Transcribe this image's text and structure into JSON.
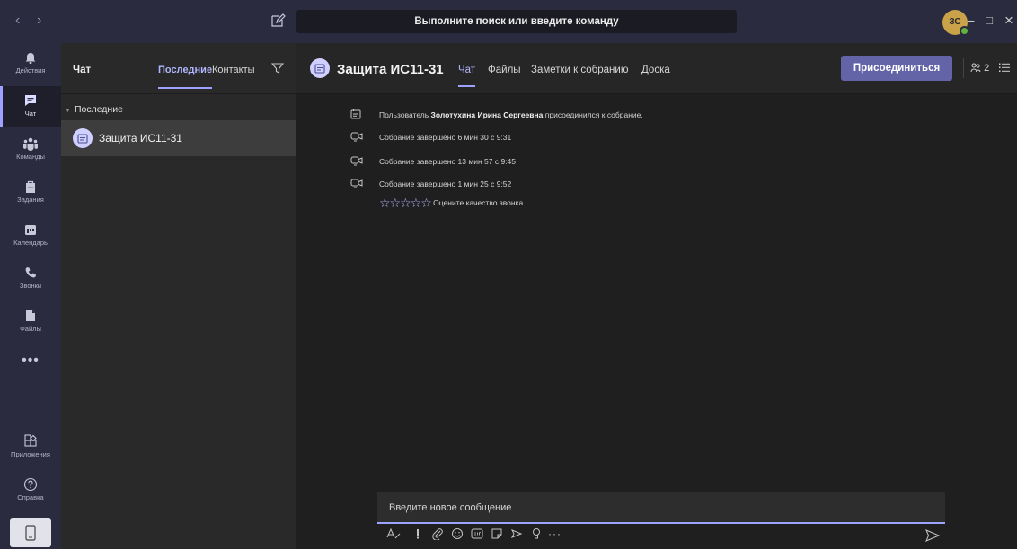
{
  "titlebar": {
    "back": "‹",
    "forward": "›",
    "search_placeholder": "Выполните поиск или введите команду",
    "avatar_initials": "ЗС",
    "minimize": "−",
    "maximize": "□",
    "close": "×"
  },
  "rail": {
    "items": [
      {
        "label": "Действия",
        "icon": "bell-icon"
      },
      {
        "label": "Чат",
        "icon": "chat-icon"
      },
      {
        "label": "Команды",
        "icon": "teams-icon"
      },
      {
        "label": "Задания",
        "icon": "assignments-icon"
      },
      {
        "label": "Календарь",
        "icon": "calendar-icon"
      },
      {
        "label": "Звонки",
        "icon": "phone-icon"
      },
      {
        "label": "Файлы",
        "icon": "file-icon"
      }
    ],
    "more": "•••",
    "apps_label": "Приложения",
    "help_label": "Справка"
  },
  "list": {
    "title": "Чат",
    "tab_recent": "Последние",
    "tab_contacts": "Контакты",
    "section": "Последние",
    "items": [
      {
        "name": "Защита ИС11-31"
      }
    ]
  },
  "main": {
    "title": "Защита ИС11-31",
    "tabs": [
      {
        "label": "Чат"
      },
      {
        "label": "Файлы"
      },
      {
        "label": "Заметки к собранию"
      },
      {
        "label": "Доска"
      }
    ],
    "join_button": "Присоединиться",
    "participants_count": "2",
    "events": [
      {
        "prefix": "Пользователь ",
        "user": "Золотухина Ирина Сергеевна",
        "suffix": " присоединился к собрание."
      },
      {
        "text": "Собрание завершено  6 мин 30 с   9:31"
      },
      {
        "text": "Собрание завершено  13 мин 57 с   9:45"
      },
      {
        "text": "Собрание завершено  1 мин 25 с   9:52"
      }
    ],
    "rating_stars": "☆☆☆☆☆",
    "rating_text": "Оцените качество звонка",
    "composer_placeholder": "Введите новое сообщение"
  },
  "colors": {
    "accent": "#6264a7",
    "accent_light": "#9ea2ff",
    "rail_bg": "#2b2b3f",
    "main_bg": "#1f1f1f",
    "presence": "#5fb340"
  }
}
